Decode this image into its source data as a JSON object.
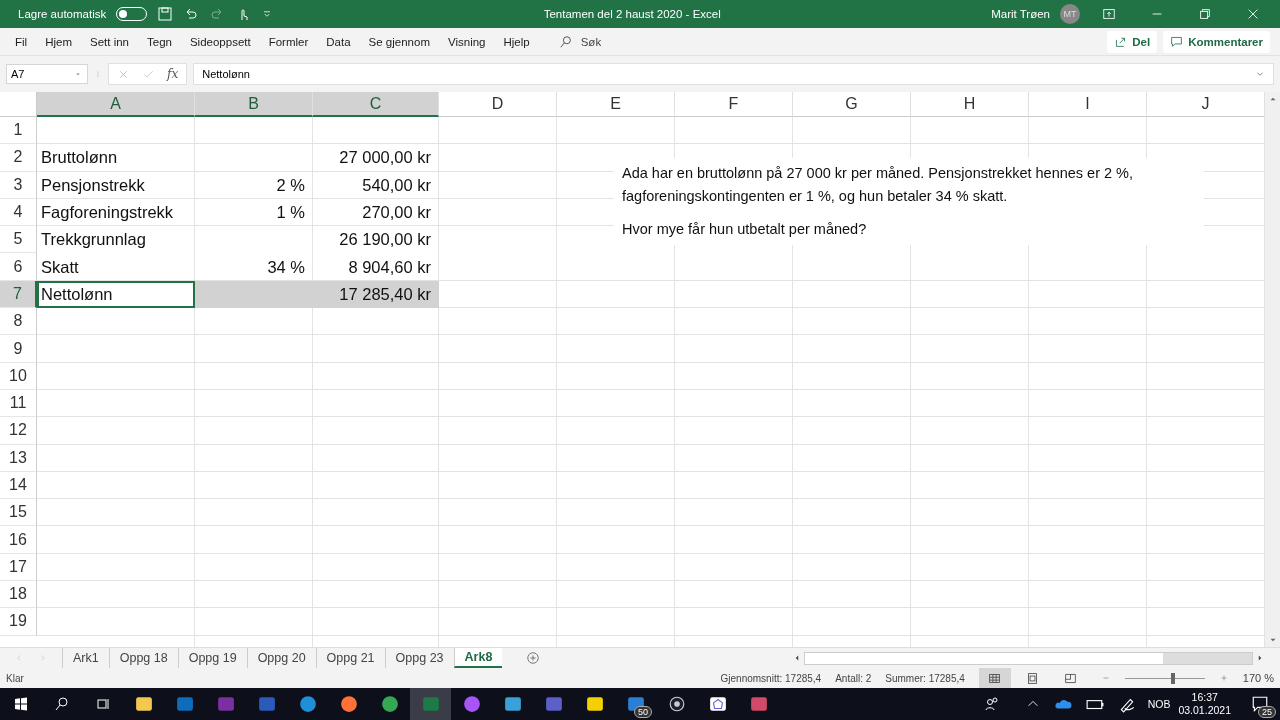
{
  "title_bar": {
    "autosave_label": "Lagre automatisk",
    "autosave_on": false,
    "title": "Tentamen del 2 haust 2020  -  Excel",
    "user_name": "Marit Trøen",
    "user_initials": "MT"
  },
  "ribbon_tabs": [
    {
      "label": "Fil"
    },
    {
      "label": "Hjem"
    },
    {
      "label": "Sett inn"
    },
    {
      "label": "Tegn"
    },
    {
      "label": "Sideoppsett"
    },
    {
      "label": "Formler"
    },
    {
      "label": "Data"
    },
    {
      "label": "Se gjennom"
    },
    {
      "label": "Visning"
    },
    {
      "label": "Hjelp"
    }
  ],
  "search_label": "Søk",
  "share_button": "Del",
  "comments_button": "Kommentarer",
  "formula_bar": {
    "name_box": "A7",
    "function_label": "fx",
    "value": "Nettolønn"
  },
  "columns": [
    {
      "label": "A",
      "selected": true
    },
    {
      "label": "B",
      "selected": true
    },
    {
      "label": "C",
      "selected": true
    },
    {
      "label": "D",
      "selected": false
    },
    {
      "label": "E",
      "selected": false
    },
    {
      "label": "F",
      "selected": false
    },
    {
      "label": "G",
      "selected": false
    },
    {
      "label": "H",
      "selected": false
    },
    {
      "label": "I",
      "selected": false
    },
    {
      "label": "J",
      "selected": false
    }
  ],
  "rows": [
    {
      "label": "1",
      "selected": false,
      "cells": {}
    },
    {
      "label": "2",
      "selected": false,
      "cells": {
        "A": "Bruttolønn",
        "C": "27 000,00 kr"
      }
    },
    {
      "label": "3",
      "selected": false,
      "cells": {
        "A": "Pensjonstrekk",
        "B": "2 %",
        "C": "540,00 kr"
      }
    },
    {
      "label": "4",
      "selected": false,
      "cells": {
        "A": "Fagforeningstrekk",
        "B": "1 %",
        "C": "270,00 kr"
      }
    },
    {
      "label": "5",
      "selected": false,
      "cells": {
        "A": "Trekkgrunnlag",
        "C": "26 190,00 kr"
      }
    },
    {
      "label": "6",
      "selected": false,
      "cells": {
        "A": "Skatt",
        "B": "34 %",
        "C": "8 904,60 kr"
      }
    },
    {
      "label": "7",
      "selected": true,
      "cells": {
        "A": "Nettolønn",
        "C": "17 285,40 kr"
      }
    },
    {
      "label": "8",
      "selected": false,
      "cells": {}
    },
    {
      "label": "9",
      "selected": false,
      "cells": {}
    },
    {
      "label": "10",
      "selected": false,
      "cells": {}
    },
    {
      "label": "11",
      "selected": false,
      "cells": {}
    },
    {
      "label": "12",
      "selected": false,
      "cells": {}
    },
    {
      "label": "13",
      "selected": false,
      "cells": {}
    },
    {
      "label": "14",
      "selected": false,
      "cells": {}
    },
    {
      "label": "15",
      "selected": false,
      "cells": {}
    },
    {
      "label": "16",
      "selected": false,
      "cells": {}
    },
    {
      "label": "17",
      "selected": false,
      "cells": {}
    },
    {
      "label": "18",
      "selected": false,
      "cells": {}
    },
    {
      "label": "19",
      "selected": false,
      "cells": {}
    }
  ],
  "text_box": {
    "paragraphs": [
      "Ada har en bruttolønn på 27 000 kr per måned. Pensjonstrekket hennes er 2 %, fagforeningskontingenten er 1 %, og hun betaler 34 % skatt.",
      "Hvor mye får hun utbetalt per måned?"
    ]
  },
  "sheet_tabs": [
    {
      "label": "Ark1",
      "selected": false
    },
    {
      "label": "Oppg 18",
      "selected": false
    },
    {
      "label": "Oppg 19",
      "selected": false
    },
    {
      "label": "Oppg 20",
      "selected": false
    },
    {
      "label": "Oppg 21",
      "selected": false
    },
    {
      "label": "Oppg 23",
      "selected": false
    },
    {
      "label": "Ark8",
      "selected": true
    }
  ],
  "status_bar": {
    "status": "Klar",
    "stats": [
      "Gjennomsnitt: 17285,4",
      "Antall: 2",
      "Summer: 17285,4"
    ],
    "views": [
      {
        "kind": "normal",
        "selected": true
      },
      {
        "kind": "page_layout",
        "selected": false
      },
      {
        "kind": "page_break",
        "selected": false
      }
    ],
    "zoom": {
      "level": 0.6,
      "label": "170 %"
    }
  },
  "taskbar": {
    "apps": [
      {
        "kind": "folder"
      },
      {
        "kind": "outlook"
      },
      {
        "kind": "onenote"
      },
      {
        "kind": "word"
      },
      {
        "kind": "edge"
      },
      {
        "kind": "firefox"
      },
      {
        "kind": "chrome"
      },
      {
        "kind": "excel",
        "selected": true
      },
      {
        "kind": "messenger"
      },
      {
        "kind": "notes"
      },
      {
        "kind": "teams"
      },
      {
        "kind": "sticky"
      },
      {
        "kind": "mail",
        "badge": "50"
      },
      {
        "kind": "record"
      },
      {
        "kind": "geogebra"
      },
      {
        "kind": "snip"
      }
    ],
    "language": "NOB",
    "time": "16:37",
    "date": "03.01.2021",
    "notifications": "25"
  }
}
